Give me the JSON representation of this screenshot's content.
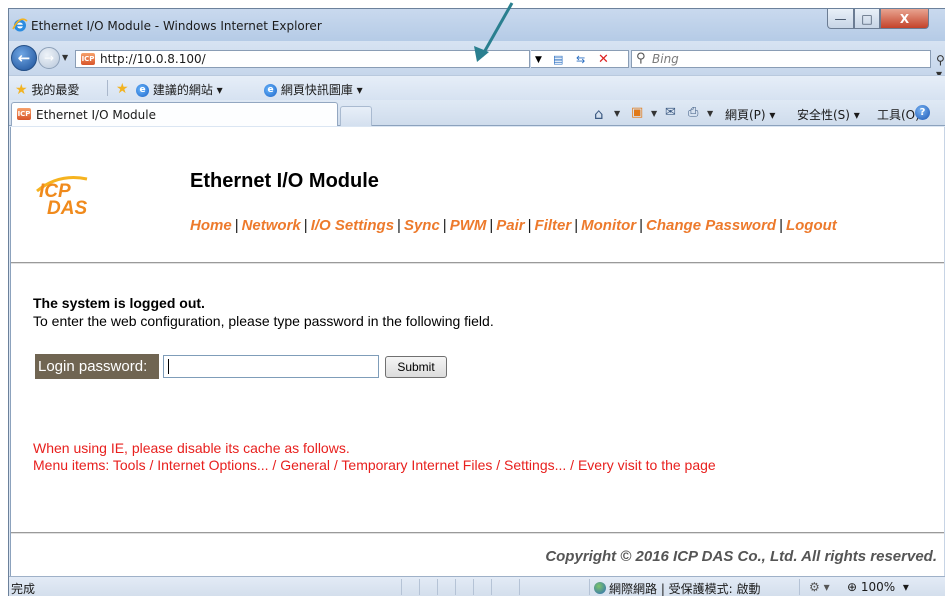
{
  "window": {
    "title": "Ethernet I/O Module - Windows Internet Explorer",
    "min_glyph": "—",
    "max_glyph": "□",
    "close_glyph": "X"
  },
  "address_bar": {
    "url": "http://10.0.8.100/",
    "search_placeholder": "Bing"
  },
  "favorites_bar": {
    "favorites_label": "我的最愛",
    "suggested_sites": "建議的網站 ▾",
    "web_slice_gallery": "網頁快訊圖庫 ▾"
  },
  "tab_bar": {
    "active_tab": "Ethernet I/O Module",
    "page_menu": "網頁(P) ▾",
    "safety_menu": "安全性(S) ▾",
    "tools_menu": "工具(O) ▾"
  },
  "page": {
    "heading": "Ethernet I/O Module",
    "logo_text": "ICP DAS",
    "nav": [
      {
        "label": "Home"
      },
      {
        "label": "Network"
      },
      {
        "label": "I/O Settings"
      },
      {
        "label": "Sync"
      },
      {
        "label": "PWM"
      },
      {
        "label": "Pair"
      },
      {
        "label": "Filter"
      },
      {
        "label": "Monitor"
      },
      {
        "label": "Change Password"
      },
      {
        "label": "Logout"
      }
    ],
    "nav_separator": "|",
    "logout_title": "The system is logged out.",
    "instruction": "To enter the web configuration, please type password in the following field.",
    "password_label": "Login password:",
    "password_value": "",
    "submit_label": "Submit",
    "ie_note_line1": "When using IE, please disable its cache as follows.",
    "ie_note_line2": "Menu items: Tools / Internet Options... / General / Temporary Internet Files / Settings... / Every visit to the page",
    "copyright": "Copyright © 2016 ICP DAS Co., Ltd. All rights reserved."
  },
  "status_bar": {
    "status": "完成",
    "zone": "網際網路 | 受保護模式: 啟動",
    "zoom": "100%"
  },
  "colors": {
    "nav_link": "#ed7a2c",
    "note_red": "#e8201e",
    "label_bg": "#706552",
    "annotation_arrow": "#2a7f8f"
  }
}
